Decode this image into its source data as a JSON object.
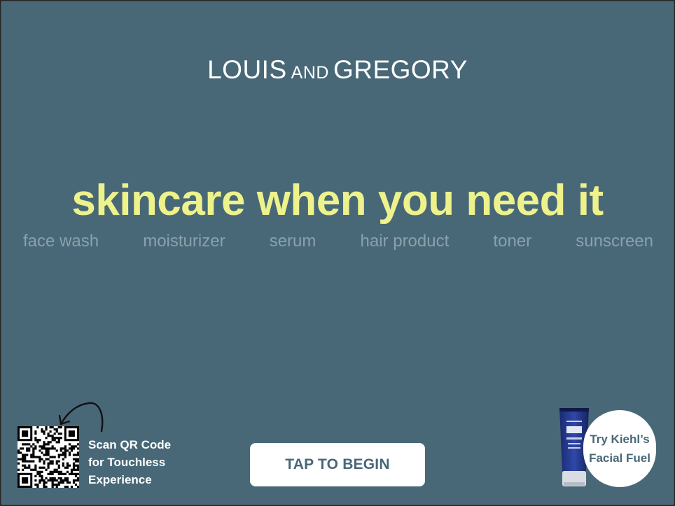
{
  "brand": {
    "part1": "LOUIS",
    "part2": "AND",
    "part3": "GREGORY"
  },
  "headline": "skincare when you need it",
  "categories": [
    "face wash",
    "moisturizer",
    "serum",
    "hair product",
    "toner",
    "sunscreen"
  ],
  "qr": {
    "line1": "Scan QR Code",
    "line2": "for Touchless",
    "line3": "Experience"
  },
  "cta": {
    "label": "TAP TO BEGIN"
  },
  "promo": {
    "line1": "Try Kiehl’s",
    "line2": "Facial Fuel"
  },
  "colors": {
    "background": "#486877",
    "headline": "#eef28b",
    "category": "#8aa1ad",
    "button_text": "#486877"
  },
  "icons": {
    "qr": "qr-code-icon",
    "arrow": "curved-arrow-icon",
    "product": "product-tube-image"
  }
}
